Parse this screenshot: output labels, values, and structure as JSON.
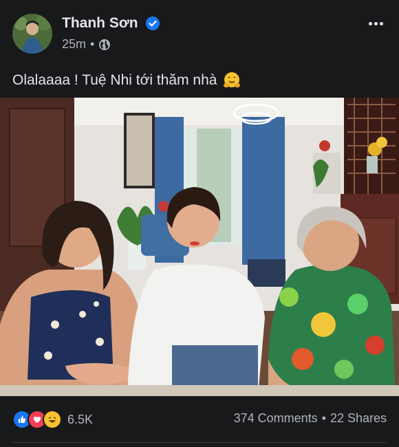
{
  "post": {
    "author": "Thanh Sơn",
    "time": "25m",
    "separator": "•",
    "caption": "Olalaaaa ! Tuệ Nhi tới thăm nhà"
  },
  "photo": {
    "alt": "Three women posing together at home"
  },
  "engagement": {
    "reaction_count": "6.5K",
    "comments": "374 Comments",
    "dot": "•",
    "shares": "22 Shares"
  },
  "colors": {
    "background": "#18191a",
    "primary_text": "#e4e6eb",
    "secondary_text": "#b0b3b8",
    "verified_blue": "#1877f2"
  },
  "icons": [
    "verified-badge-icon",
    "globe-icon",
    "more-options-icon",
    "hugging-face-emoji-icon",
    "like-reaction-icon",
    "love-reaction-icon",
    "haha-reaction-icon"
  ]
}
